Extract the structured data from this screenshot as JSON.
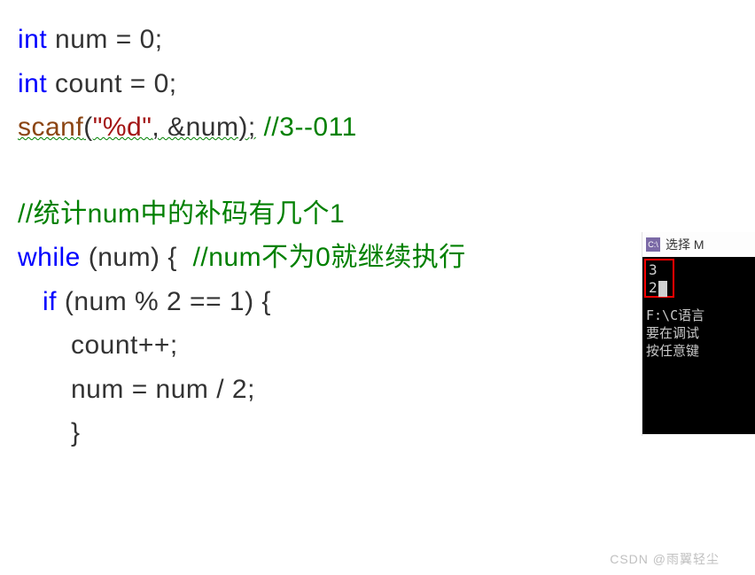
{
  "code": {
    "line1": {
      "kw": "int",
      "rest": " num = 0;"
    },
    "line2": {
      "kw": "int",
      "rest": " count = 0;"
    },
    "line3": {
      "func": "scanf",
      "paren_open": "(",
      "str": "\"%d\"",
      "args_rest": ", &num);",
      "comment": " //3--011"
    },
    "line4": {
      "comment": "//统计num中的补码有几个1"
    },
    "line5": {
      "kw": "while",
      "rest": " (num) {  ",
      "comment": "//num不为0就继续执行"
    },
    "line6": {
      "kw": "if",
      "rest": " (num % 2 == 1) {"
    },
    "line7": {
      "text": "count++;"
    },
    "line8": {
      "text": "num = num / 2;"
    },
    "line9": {
      "text": "}"
    }
  },
  "console": {
    "title_icon": "C:\\",
    "title": "选择 M",
    "out1": "3",
    "out2": "2",
    "t1": "F:\\C语言",
    "t2": "要在调试",
    "t3": "按任意键"
  },
  "watermark": "CSDN @雨翼轻尘"
}
